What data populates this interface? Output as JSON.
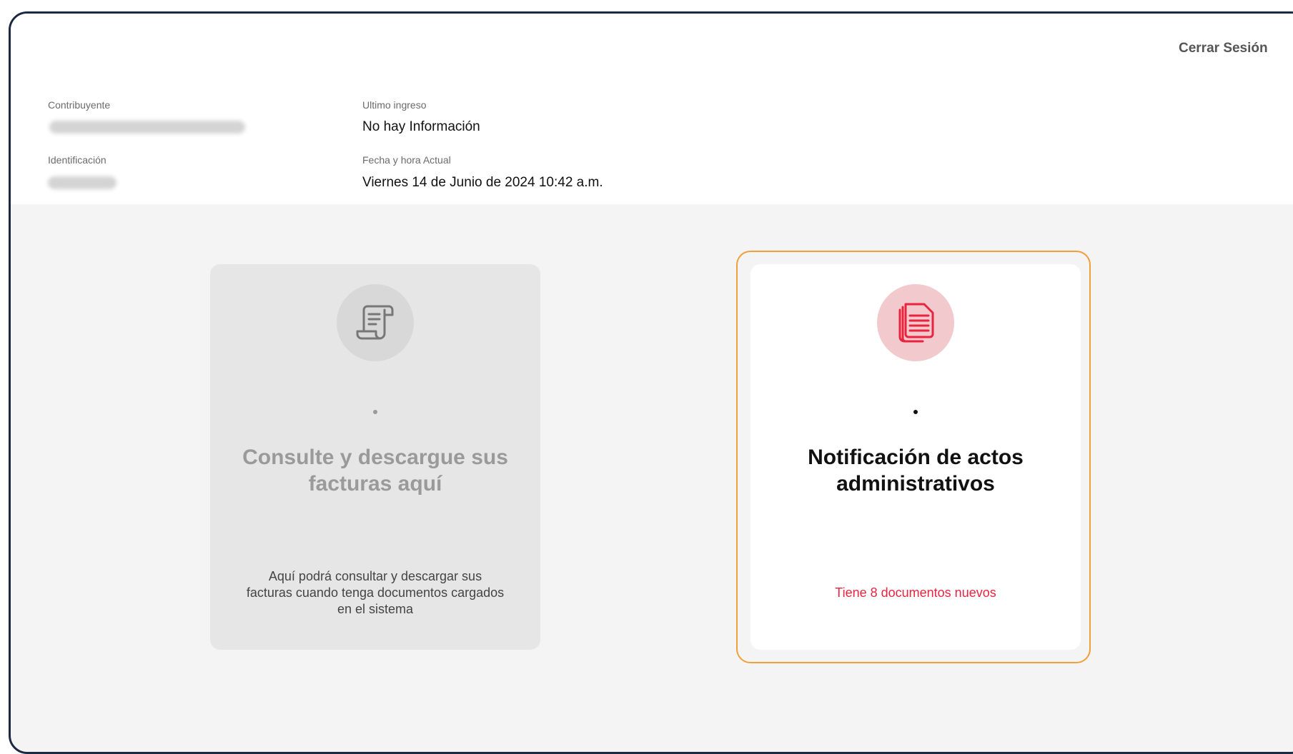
{
  "header": {
    "logout_label": "Cerrar Sesión",
    "taxpayer_label": "Contribuyente",
    "id_label": "Identificación",
    "last_login_label": "Ultimo ingreso",
    "last_login_value": "No hay Información",
    "current_datetime_label": "Fecha y hora Actual",
    "current_datetime_value": "Viernes 14 de Junio de 2024 10:42 a.m."
  },
  "cards": [
    {
      "icon": "receipt-scroll-icon",
      "title": "Consulte y descargue sus facturas aquí",
      "description": "Aquí podrá consultar y descargar sus facturas cuando tenga documentos cargados en el sistema",
      "enabled": false
    },
    {
      "icon": "documents-icon",
      "title": "Notificación de actos administrativos",
      "note": "Tiene 8 documentos nuevos",
      "enabled": true
    }
  ],
  "colors": {
    "accent_border": "#f0a03a",
    "alert_text": "#e8243f",
    "icon_red": "#e8243f",
    "frame_border": "#1b2a41"
  }
}
